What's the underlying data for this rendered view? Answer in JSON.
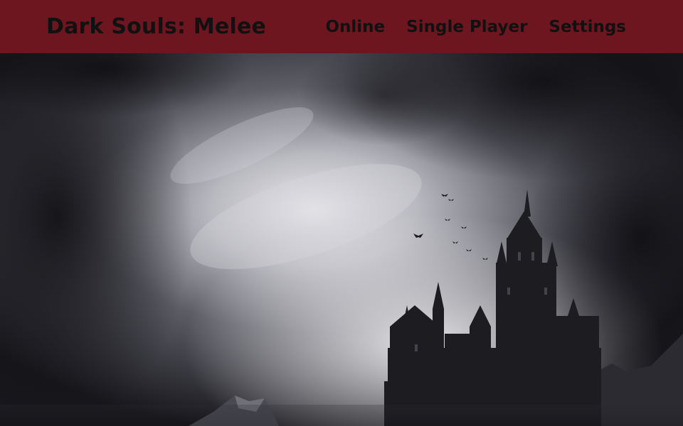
{
  "header": {
    "title": "Dark Souls: Melee",
    "nav": [
      {
        "label": "Online"
      },
      {
        "label": "Single Player"
      },
      {
        "label": "Settings"
      }
    ]
  },
  "theme": {
    "navbar_bg": "#6e1620",
    "text_color": "#111111"
  },
  "hero": {
    "image": "gothic-castle-stormy-sky"
  }
}
